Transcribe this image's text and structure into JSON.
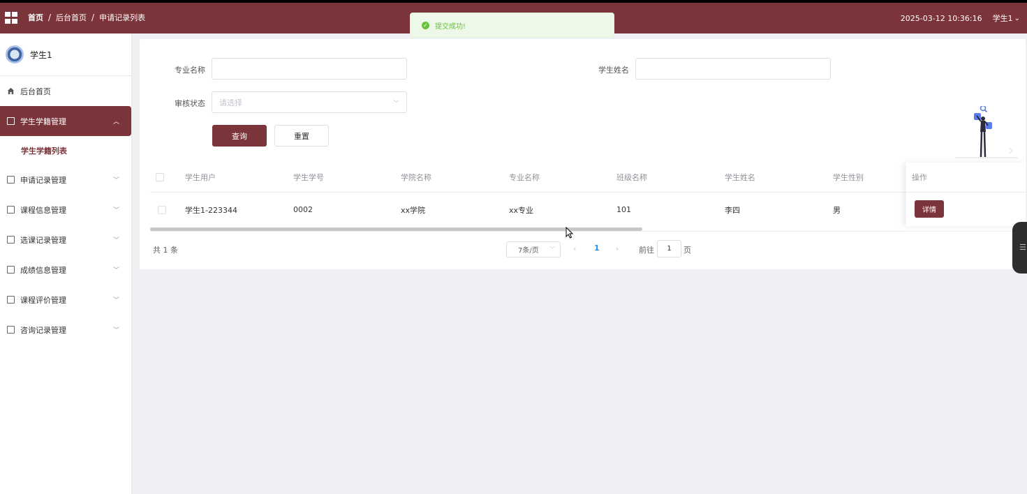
{
  "header": {
    "breadcrumb": [
      "首页",
      "后台首页",
      "申请记录列表"
    ],
    "datetime": "2025-03-12 10:36:16",
    "user_label": "学生1",
    "user_chevron": "⌄",
    "bg_color": "#7b3439"
  },
  "toast": {
    "message": "提交成功!",
    "icon": "check-circle-icon"
  },
  "sidebar": {
    "user_name": "学生1",
    "items": [
      {
        "label": "后台首页",
        "icon": "home-icon"
      },
      {
        "label": "学生学籍管理",
        "icon": "doc-icon",
        "active": true,
        "expanded": true
      },
      {
        "label": "申请记录管理",
        "icon": "doc-icon"
      },
      {
        "label": "课程信息管理",
        "icon": "doc-icon"
      },
      {
        "label": "选课记录管理",
        "icon": "doc-icon"
      },
      {
        "label": "成绩信息管理",
        "icon": "doc-icon"
      },
      {
        "label": "课程评价管理",
        "icon": "doc-icon"
      },
      {
        "label": "咨询记录管理",
        "icon": "doc-icon"
      }
    ],
    "sub_item": "学生学籍列表"
  },
  "search": {
    "major_label": "专业名称",
    "major_value": "",
    "student_name_label": "学生姓名",
    "student_name_value": "",
    "status_label": "审核状态",
    "status_placeholder": "请选择",
    "query_button": "查询",
    "reset_button": "重置"
  },
  "table": {
    "columns": [
      "学生用户",
      "学生学号",
      "学院名称",
      "专业名称",
      "班级名称",
      "学生姓名",
      "学生性别",
      "操作"
    ],
    "rows": [
      [
        "学生1-223344",
        "0002",
        "xx学院",
        "xx专业",
        "101",
        "李四",
        "男"
      ]
    ],
    "action_button": "详情",
    "horizontal_scroll_fraction": 0.56
  },
  "pagination": {
    "total": "共 1 条",
    "page_size": "7条/页",
    "prev": "‹",
    "current_page": "1",
    "next": "›",
    "goto_prefix": "前往",
    "goto_value": "1",
    "goto_suffix": "页"
  }
}
